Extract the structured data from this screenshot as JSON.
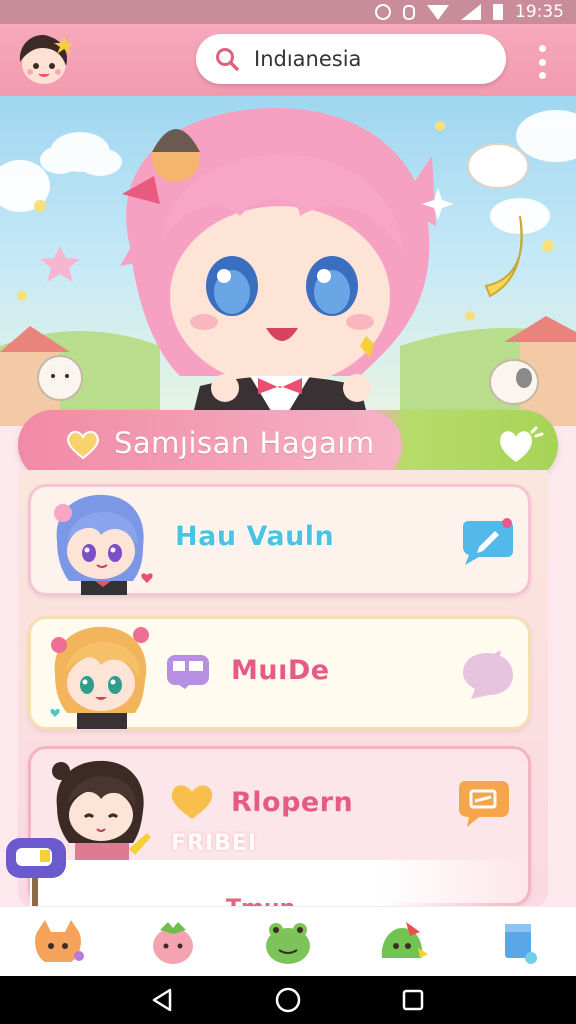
{
  "status_bar": {
    "time": "19:35",
    "icons": [
      "alarm-icon",
      "sync-icon",
      "wifi-icon",
      "signal-icon",
      "battery-icon"
    ]
  },
  "app_bar": {
    "avatar": "chibi-avatar-icon",
    "search": {
      "value": "Indıanesia",
      "icon": "search-icon"
    },
    "menu_icon": "kebab-menu-icon"
  },
  "hero": {
    "illustration": "pink-haired-chibi-character"
  },
  "banner": {
    "title": "Samȷisan Hagaım",
    "left_icon": "heart-icon",
    "right_icon": "heart-favorite-icon",
    "colors": {
      "pink": "#f48aa7",
      "green": "#a6d457"
    }
  },
  "list": [
    {
      "title": "Hau Vauln",
      "character": "blue-haired-chibi",
      "action_icon": "chat-edit-icon",
      "color": "#4cc3e2"
    },
    {
      "title": "MuıDe",
      "character": "blonde-chibi",
      "label_icon": "sticker-label-icon",
      "action_icon": "chat-bubble-icon",
      "color": "#e65a88"
    },
    {
      "title": "Rlopern",
      "sub_label": "FRIBEI",
      "character": "dark-haired-chibi",
      "label_icon": "heart-icon",
      "action_icon": "message-icon",
      "color": "#e65a88"
    }
  ],
  "partial_item": {
    "title": "Tmun"
  },
  "tabs": [
    {
      "icon": "cat-tab-icon"
    },
    {
      "icon": "strawberry-tab-icon"
    },
    {
      "icon": "frog-tab-icon"
    },
    {
      "icon": "slime-tab-icon"
    },
    {
      "icon": "cup-tab-icon"
    }
  ],
  "nav": [
    "back-icon",
    "home-icon",
    "recents-icon"
  ]
}
